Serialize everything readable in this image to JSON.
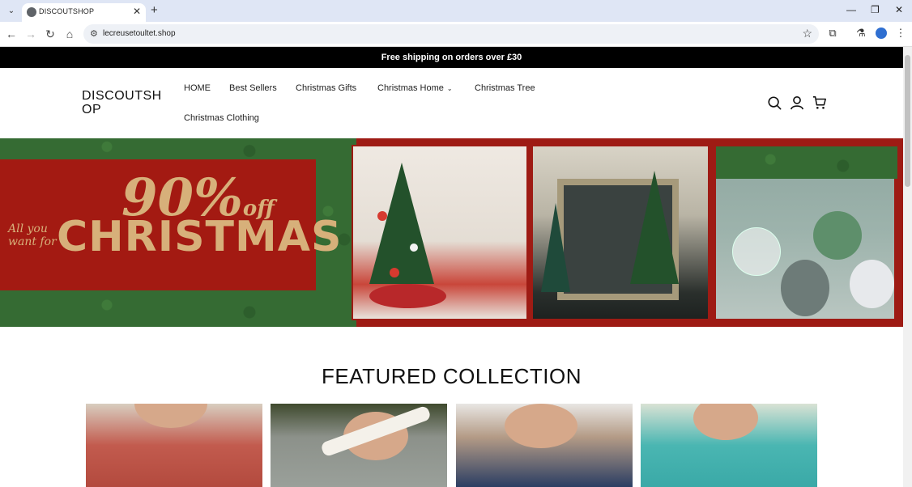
{
  "browser": {
    "tab_title": "DISCOUTSHOP",
    "url": "lecreusetoultet.shop",
    "glyphs": {
      "tab_menu": "⌄",
      "tab_close": "✕",
      "new_tab": "+",
      "minimize": "—",
      "restore": "❐",
      "close": "✕",
      "back": "←",
      "forward": "→",
      "reload": "↻",
      "home": "⌂",
      "site_info": "⚙",
      "bookmark": "☆",
      "extensions": "⧉",
      "labs": "⚗",
      "menu": "⋮"
    }
  },
  "announcement": {
    "text": "Free shipping on orders over £30"
  },
  "header": {
    "logo": "DISCOUTSHOP",
    "nav": [
      {
        "label": "HOME"
      },
      {
        "label": "Best Sellers"
      },
      {
        "label": "Christmas Gifts"
      },
      {
        "label": "Christmas Home",
        "chevron": "⌄"
      },
      {
        "label": "Christmas Tree"
      },
      {
        "label": "Christmas Clothing"
      }
    ],
    "icons": [
      "search-icon",
      "account-icon",
      "cart-icon"
    ]
  },
  "hero": {
    "percent": "90%",
    "off": "off",
    "headline": "CHRISTMAS",
    "tagline": "All you want for"
  },
  "featured": {
    "title": "FEATURED COLLECTION"
  },
  "colors": {
    "announcement_bg": "#000000",
    "hero_red": "#a31a12",
    "hero_gold": "#d7b07a",
    "tabbar_bg": "#dfe6f5"
  }
}
